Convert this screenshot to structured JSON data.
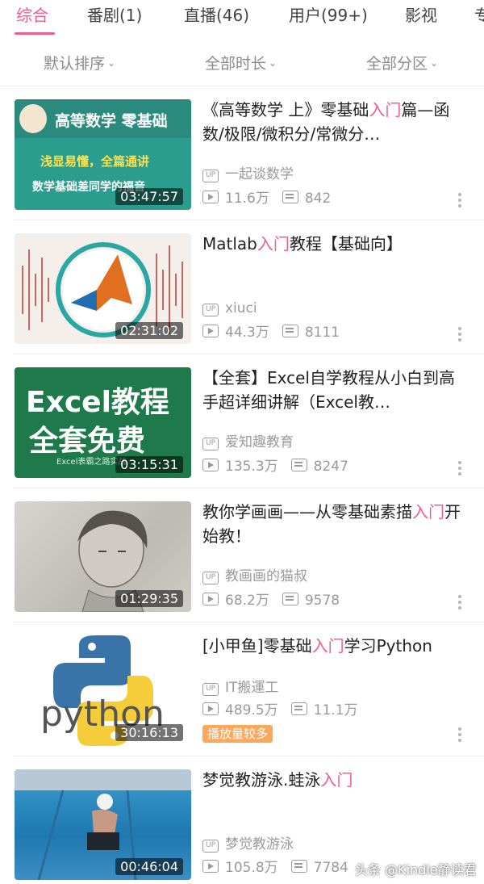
{
  "tabs": [
    {
      "label": "综合",
      "active": true
    },
    {
      "label": "番剧(1)",
      "active": false
    },
    {
      "label": "直播(46)",
      "active": false
    },
    {
      "label": "用户(99+)",
      "active": false
    },
    {
      "label": "影视",
      "active": false
    },
    {
      "label": "专",
      "active": false
    }
  ],
  "filters": [
    {
      "label": "默认排序"
    },
    {
      "label": "全部时长"
    },
    {
      "label": "全部分区"
    }
  ],
  "accent_color": "#f25d8e",
  "videos": [
    {
      "title_before": "《高等数学 上》零基础",
      "title_highlight": "入门",
      "title_after": "篇—函数/极限/微积分/常微分…",
      "uploader": "一起谈数学",
      "views": "11.6万",
      "danmaku": "842",
      "duration": "03:47:57",
      "thumb_text_1": "高等数学 零基础",
      "thumb_text_2": "浅显易懂，全篇通讲",
      "thumb_text_3": "数学基础差同学的福音"
    },
    {
      "title_before": "Matlab",
      "title_highlight": "入门",
      "title_after": "教程【基础向】",
      "uploader": "xiuci",
      "views": "44.3万",
      "danmaku": "8111",
      "duration": "02:31:02"
    },
    {
      "title_before": "【全套】Excel自学教程从小白到高手超详细讲解（Excel教…",
      "title_highlight": "",
      "title_after": "",
      "uploader": "爱知趣教育",
      "views": "135.3万",
      "danmaku": "8247",
      "duration": "03:15:31",
      "thumb_text_1": "Excel教程",
      "thumb_text_2": "全套免费",
      "thumb_text_3": "Excel表霸之路实战"
    },
    {
      "title_before": "教你学画画——从零基础素描",
      "title_highlight": "入门",
      "title_after": "开始教！",
      "uploader": "教画画的猫叔",
      "views": "68.2万",
      "danmaku": "9578",
      "duration": "01:29:35"
    },
    {
      "title_before": "[小甲鱼]零基础",
      "title_highlight": "入门",
      "title_after": "学习Python",
      "uploader": "IT搬運工",
      "views": "489.5万",
      "danmaku": "11.1万",
      "duration": "30:16:13",
      "tag": "播放量较多",
      "thumb_text_1": "python"
    },
    {
      "title_before": "梦觉教游泳.蛙泳",
      "title_highlight": "入门",
      "title_after": "",
      "uploader": "梦觉教游泳",
      "views": "105.8万",
      "danmaku": "7784",
      "duration": "00:46:04"
    }
  ],
  "watermark": "头条 @Kindle静读君"
}
